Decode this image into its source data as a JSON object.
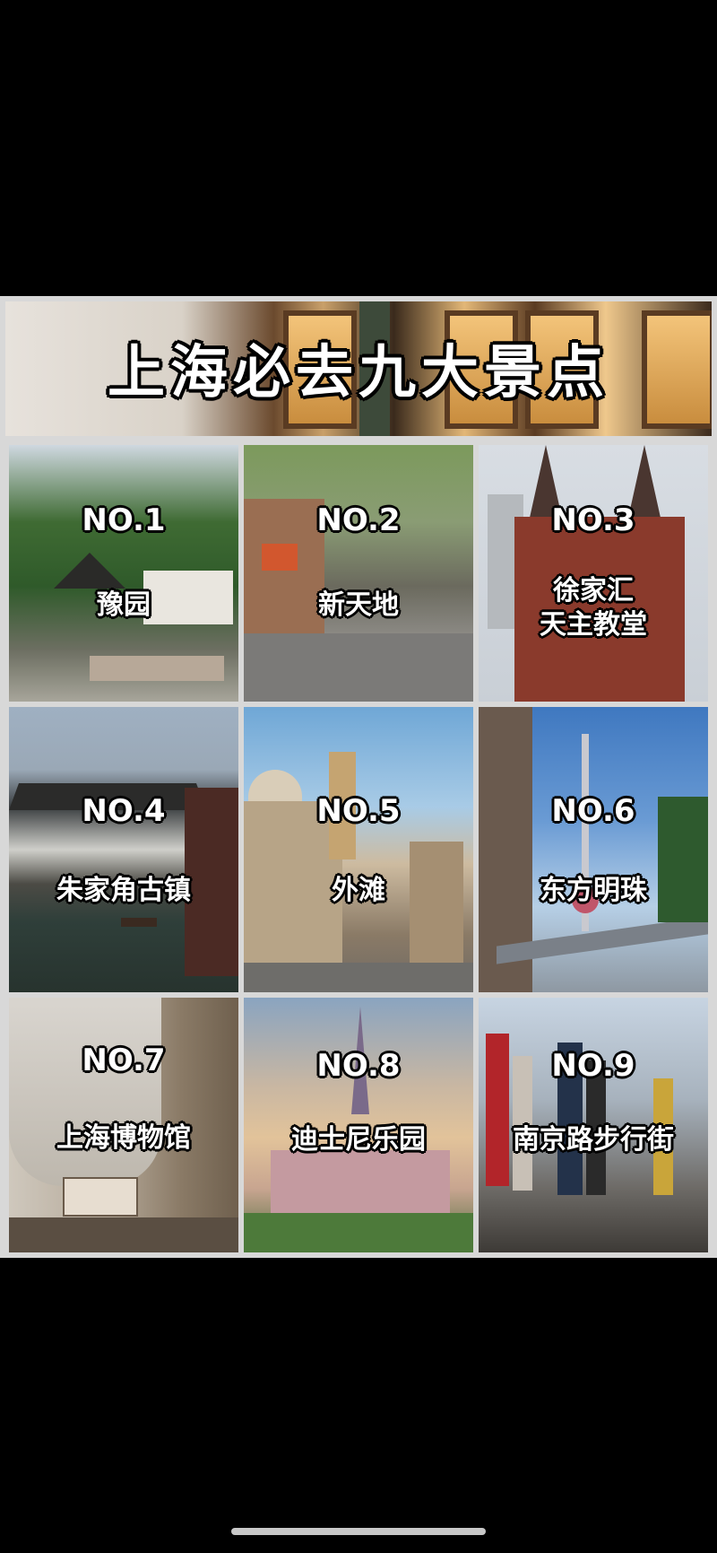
{
  "banner": {
    "title": "上海必去九大景点"
  },
  "spots": [
    {
      "no": "NO.1",
      "name": "豫园"
    },
    {
      "no": "NO.2",
      "name": "新天地"
    },
    {
      "no": "NO.3",
      "name": "徐家汇",
      "name2": "天主教堂"
    },
    {
      "no": "NO.4",
      "name": "朱家角古镇"
    },
    {
      "no": "NO.5",
      "name": "外滩"
    },
    {
      "no": "NO.6",
      "name": "东方明珠"
    },
    {
      "no": "NO.7",
      "name": "上海博物馆"
    },
    {
      "no": "NO.8",
      "name": "迪士尼乐园"
    },
    {
      "no": "NO.9",
      "name": "南京路步行街"
    }
  ]
}
